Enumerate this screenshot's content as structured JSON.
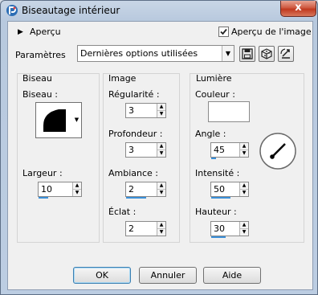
{
  "window": {
    "title": "Biseautage intérieur",
    "close_glyph": "x"
  },
  "top": {
    "preview_toggle": "Aperçu",
    "preview_check_label": "Aperçu de l'image",
    "preview_checked": true,
    "params_label": "Paramètres",
    "preset_value": "Dernières options utilisées"
  },
  "bevel": {
    "group_title": "Biseau",
    "bevel_label": "Biseau :",
    "width_label": "Largeur :",
    "width_value": "10"
  },
  "image": {
    "group_title": "Image",
    "smoothness_label": "Régularité :",
    "smoothness_value": "3",
    "depth_label": "Profondeur :",
    "depth_value": "3",
    "ambience_label": "Ambiance :",
    "ambience_value": "2",
    "shininess_label": "Éclat :",
    "shininess_value": "2"
  },
  "light": {
    "group_title": "Lumière",
    "color_label": "Couleur :",
    "color_value": "#ffffff",
    "angle_label": "Angle :",
    "angle_value": "45",
    "intensity_label": "Intensité :",
    "intensity_value": "50",
    "elevation_label": "Hauteur :",
    "elevation_value": "30"
  },
  "buttons": {
    "ok": "OK",
    "cancel": "Annuler",
    "help": "Aide"
  },
  "icons": [
    "app-icon",
    "save-preset-icon",
    "reset-icon",
    "restore-icon",
    "angle-dial-icon"
  ]
}
